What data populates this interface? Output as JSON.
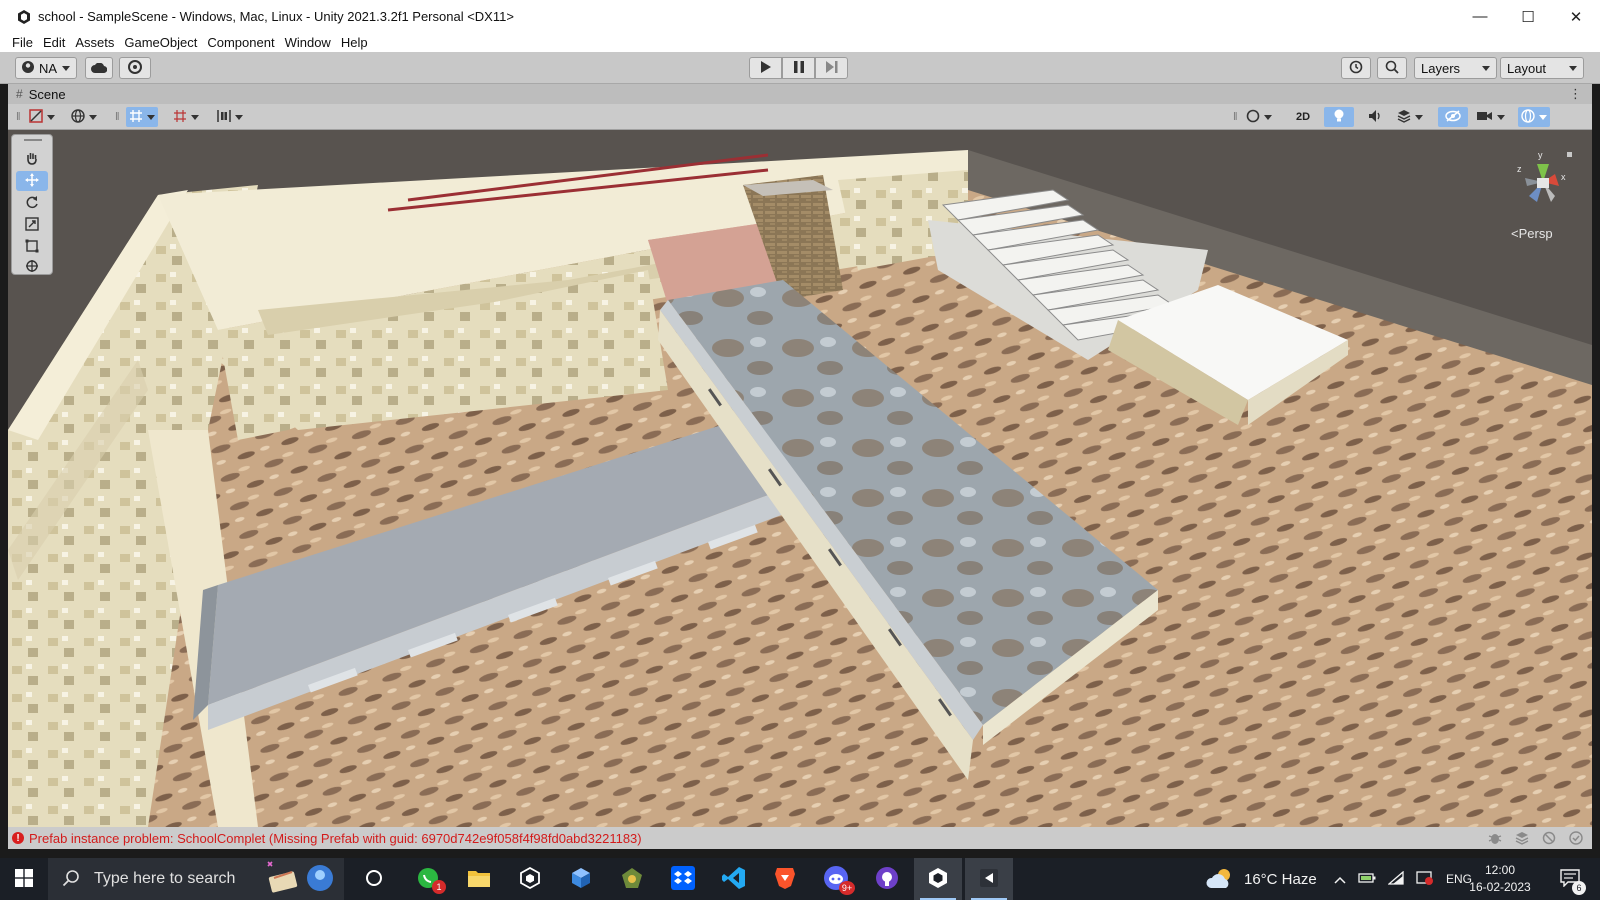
{
  "window": {
    "title": "school - SampleScene - Windows, Mac, Linux - Unity 2021.3.2f1 Personal <DX11>",
    "controls": [
      "minimize-icon",
      "maximize-icon",
      "close-icon"
    ]
  },
  "menu": {
    "items": [
      "File",
      "Edit",
      "Assets",
      "GameObject",
      "Component",
      "Window",
      "Help"
    ]
  },
  "toolbar": {
    "account_label": "NA",
    "layers_label": "Layers",
    "layout_label": "Layout"
  },
  "scene": {
    "tab_label": "Scene",
    "toggle_2d": "2D",
    "projection_label": "<Persp",
    "gizmo_axes": [
      "y",
      "x",
      "z"
    ]
  },
  "status": {
    "message": "Prefab instance problem: SchoolComplet (Missing Prefab with guid: 6970d742e9f058f4f98fd0abd3221183)"
  },
  "taskbar": {
    "search_placeholder": "Type here to search",
    "whatsapp_badge": "1",
    "discord_badge": "9+",
    "weather": "16°C  Haze",
    "language": "ENG",
    "time": "12:00",
    "date": "16-02-2023",
    "notification_count": "6"
  },
  "colors": {
    "unity_accent": "#8ab6ea",
    "error_red": "#d31c1c",
    "taskbar_bg": "#1b1f26"
  }
}
